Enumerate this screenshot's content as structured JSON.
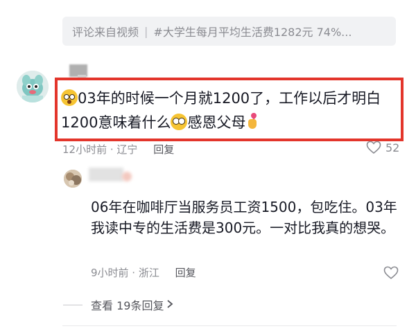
{
  "source_bar": {
    "label": "评论来自视频",
    "topic": "#大学生每月平均生活费1282元 74%..."
  },
  "main_comment": {
    "text_1": "03年的时候一个月就1200了，工作以后才明白1200意味着什么",
    "text_2": "感恩父母",
    "time_location": "12小时前 · 辽宁",
    "reply_label": "回复",
    "likes": "52",
    "highlight_color": "#e3352b"
  },
  "reply_comment": {
    "text": "06年在咖啡厅当服务员工资1500，包吃住。03年我读中专的生活费是300元。一对比我真的想哭。",
    "time_location": "9小时前 · 浙江",
    "reply_label": "回复"
  },
  "expand_replies": {
    "label": "查看 19条回复"
  }
}
